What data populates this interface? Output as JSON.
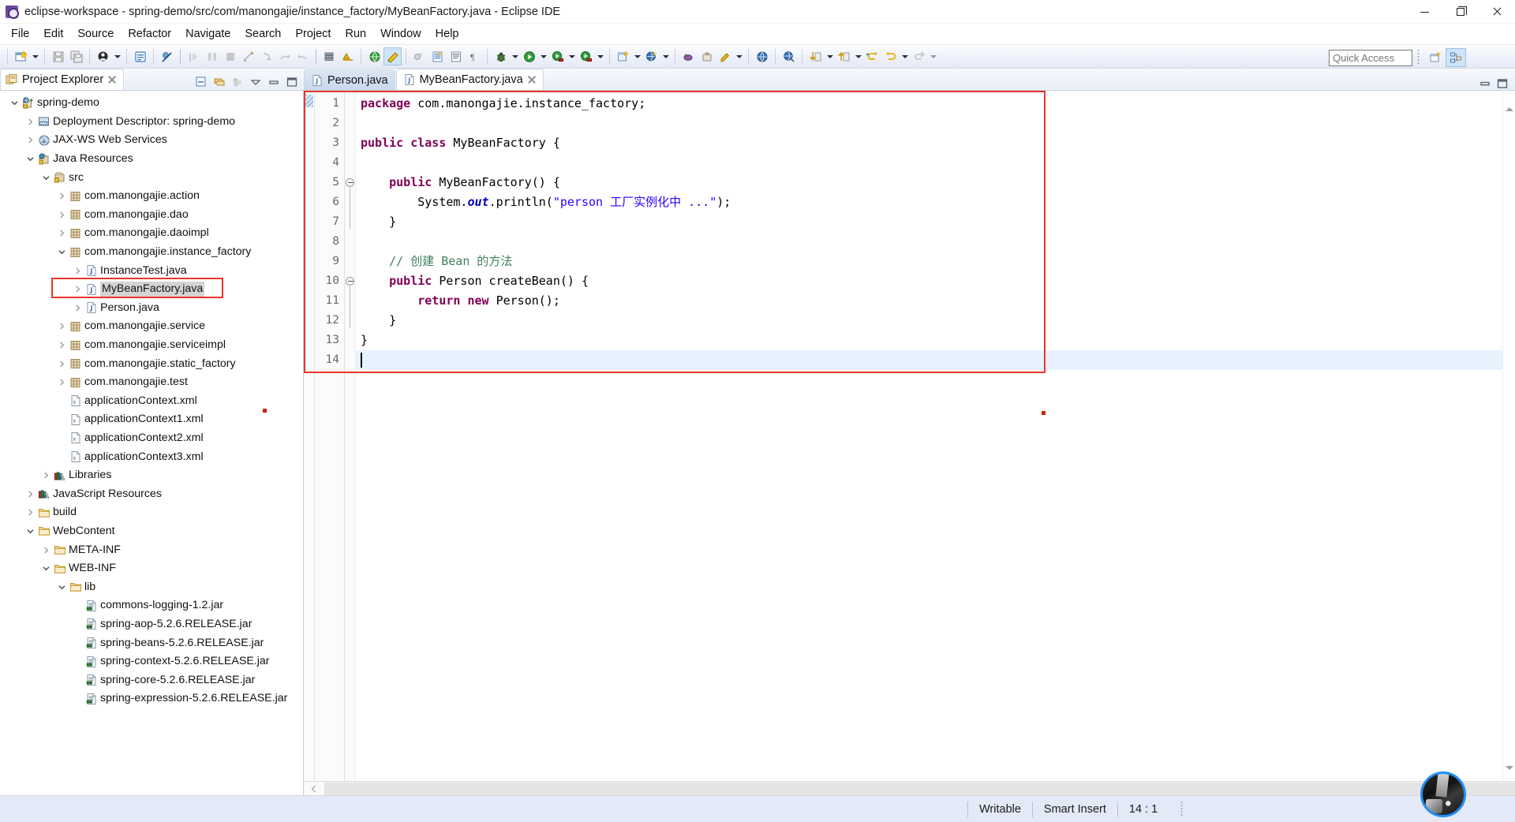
{
  "window": {
    "title": "eclipse-workspace - spring-demo/src/com/manongajie/instance_factory/MyBeanFactory.java - Eclipse IDE",
    "app_icon": "eclipse-icon",
    "minimize_label": "Minimize",
    "maximize_label": "Restore",
    "close_label": "Close"
  },
  "menubar": {
    "items": [
      {
        "label": "File"
      },
      {
        "label": "Edit"
      },
      {
        "label": "Source"
      },
      {
        "label": "Refactor"
      },
      {
        "label": "Navigate"
      },
      {
        "label": "Search"
      },
      {
        "label": "Project"
      },
      {
        "label": "Run"
      },
      {
        "label": "Window"
      },
      {
        "label": "Help"
      }
    ]
  },
  "toolbar": {
    "quick_access_placeholder": "Quick Access",
    "quick_access_value": "",
    "groups": [
      {
        "buttons": [
          {
            "icon": "new-wizard-icon",
            "dropdown": true
          },
          {
            "icon": "save-icon",
            "dropdown": false
          },
          {
            "icon": "save-all-icon",
            "dropdown": false
          }
        ]
      },
      {
        "buttons": [
          {
            "icon": "new-java-class-icon",
            "dropdown": true
          }
        ]
      },
      {
        "buttons": [
          {
            "icon": "open-type-icon",
            "dropdown": false
          }
        ]
      },
      {
        "buttons": [
          {
            "icon": "skip-breakpoints-icon",
            "dropdown": false
          }
        ]
      },
      {
        "buttons": [
          {
            "icon": "resume-icon",
            "dropdown": false
          },
          {
            "icon": "suspend-icon",
            "dropdown": false
          },
          {
            "icon": "terminate-icon",
            "dropdown": false
          },
          {
            "icon": "disconnect-icon",
            "dropdown": false
          },
          {
            "icon": "step-into-icon",
            "dropdown": false
          },
          {
            "icon": "step-over-icon",
            "dropdown": false
          },
          {
            "icon": "step-return-icon",
            "dropdown": false
          }
        ]
      },
      {
        "buttons": [
          {
            "icon": "new-server-icon",
            "dropdown": false
          },
          {
            "icon": "publish-icon",
            "dropdown": false
          }
        ]
      },
      {
        "buttons": [
          {
            "icon": "open-web-browser-icon",
            "dropdown": false
          },
          {
            "icon": "toggle-mark-occurrences-icon",
            "dropdown": false
          }
        ]
      },
      {
        "buttons": [
          {
            "icon": "new-xml-icon",
            "dropdown": false
          },
          {
            "icon": "new-jsp-icon",
            "dropdown": false
          },
          {
            "icon": "show-whitespace-icon",
            "dropdown": false
          }
        ]
      },
      {
        "buttons": [
          {
            "icon": "debug-icon",
            "dropdown": true
          },
          {
            "icon": "run-icon",
            "dropdown": true
          },
          {
            "icon": "run-external-tools-icon",
            "dropdown": true
          },
          {
            "icon": "profile-icon",
            "dropdown": true
          }
        ]
      },
      {
        "buttons": [
          {
            "icon": "new-java-project-icon",
            "dropdown": true
          },
          {
            "icon": "new-package-icon",
            "dropdown": true
          }
        ]
      },
      {
        "buttons": [
          {
            "icon": "search-icon",
            "dropdown": false
          },
          {
            "icon": "open-task-icon",
            "dropdown": false
          },
          {
            "icon": "annotation-icon",
            "dropdown": true
          }
        ]
      },
      {
        "buttons": [
          {
            "icon": "globe-icon",
            "dropdown": false
          }
        ]
      },
      {
        "buttons": [
          {
            "icon": "globe-search-icon",
            "dropdown": false
          }
        ]
      },
      {
        "buttons": [
          {
            "icon": "next-annotation-icon",
            "dropdown": true
          },
          {
            "icon": "previous-annotation-icon",
            "dropdown": true
          }
        ]
      },
      {
        "buttons": [
          {
            "icon": "back-icon",
            "dropdown": false
          },
          {
            "icon": "forward-icon",
            "dropdown": true
          },
          {
            "icon": "last-edit-location-icon",
            "dropdown": true
          }
        ]
      }
    ],
    "perspective_buttons": [
      {
        "icon": "open-perspective-icon",
        "active": false
      },
      {
        "icon": "java-ee-perspective-icon",
        "active": true
      }
    ]
  },
  "explorer": {
    "tab_label": "Project Explorer",
    "tab_icon": "project-explorer-icon",
    "close_icon": "close-icon",
    "view_tools": [
      {
        "icon": "collapse-all-icon"
      },
      {
        "icon": "link-with-editor-icon"
      },
      {
        "icon": "focus-on-active-task-icon"
      },
      {
        "icon": "view-menu-icon"
      },
      {
        "icon": "minimize-view-icon"
      },
      {
        "icon": "maximize-view-icon"
      }
    ],
    "tree": [
      {
        "depth": 0,
        "twisty": "expanded",
        "icon": "dynamic-web-project-icon",
        "label": "spring-demo"
      },
      {
        "depth": 1,
        "twisty": "collapsed",
        "icon": "deployment-descriptor-icon",
        "label": "Deployment Descriptor: spring-demo"
      },
      {
        "depth": 1,
        "twisty": "collapsed",
        "icon": "jaxws-icon",
        "label": "JAX-WS Web Services"
      },
      {
        "depth": 1,
        "twisty": "expanded",
        "icon": "java-resources-icon",
        "label": "Java Resources"
      },
      {
        "depth": 2,
        "twisty": "expanded",
        "icon": "source-folder-icon",
        "label": "src"
      },
      {
        "depth": 3,
        "twisty": "collapsed",
        "icon": "package-icon",
        "label": "com.manongajie.action"
      },
      {
        "depth": 3,
        "twisty": "collapsed",
        "icon": "package-icon",
        "label": "com.manongajie.dao"
      },
      {
        "depth": 3,
        "twisty": "collapsed",
        "icon": "package-icon",
        "label": "com.manongajie.daoimpl"
      },
      {
        "depth": 3,
        "twisty": "expanded",
        "icon": "package-icon",
        "label": "com.manongajie.instance_factory"
      },
      {
        "depth": 4,
        "twisty": "collapsed",
        "icon": "java-file-icon",
        "label": "InstanceTest.java"
      },
      {
        "depth": 4,
        "twisty": "collapsed",
        "icon": "java-file-icon",
        "label": "MyBeanFactory.java",
        "selected": true,
        "highlighted": true
      },
      {
        "depth": 4,
        "twisty": "collapsed",
        "icon": "java-file-icon",
        "label": "Person.java"
      },
      {
        "depth": 3,
        "twisty": "collapsed",
        "icon": "package-icon",
        "label": "com.manongajie.service"
      },
      {
        "depth": 3,
        "twisty": "collapsed",
        "icon": "package-icon",
        "label": "com.manongajie.serviceimpl"
      },
      {
        "depth": 3,
        "twisty": "collapsed",
        "icon": "package-icon",
        "label": "com.manongajie.static_factory"
      },
      {
        "depth": 3,
        "twisty": "collapsed",
        "icon": "package-icon",
        "label": "com.manongajie.test"
      },
      {
        "depth": 3,
        "twisty": "none",
        "icon": "xml-file-icon",
        "label": "applicationContext.xml"
      },
      {
        "depth": 3,
        "twisty": "none",
        "icon": "xml-file-icon",
        "label": "applicationContext1.xml"
      },
      {
        "depth": 3,
        "twisty": "none",
        "icon": "xml-file-icon",
        "label": "applicationContext2.xml"
      },
      {
        "depth": 3,
        "twisty": "none",
        "icon": "xml-file-icon",
        "label": "applicationContext3.xml"
      },
      {
        "depth": 2,
        "twisty": "collapsed",
        "icon": "libraries-icon",
        "label": "Libraries"
      },
      {
        "depth": 1,
        "twisty": "collapsed",
        "icon": "libraries-icon",
        "label": "JavaScript Resources"
      },
      {
        "depth": 1,
        "twisty": "collapsed",
        "icon": "folder-icon",
        "label": "build"
      },
      {
        "depth": 1,
        "twisty": "expanded",
        "icon": "folder-icon",
        "label": "WebContent"
      },
      {
        "depth": 2,
        "twisty": "collapsed",
        "icon": "folder-icon",
        "label": "META-INF"
      },
      {
        "depth": 2,
        "twisty": "expanded",
        "icon": "folder-icon",
        "label": "WEB-INF"
      },
      {
        "depth": 3,
        "twisty": "expanded",
        "icon": "folder-icon",
        "label": "lib"
      },
      {
        "depth": 4,
        "twisty": "none",
        "icon": "jar-icon",
        "label": "commons-logging-1.2.jar"
      },
      {
        "depth": 4,
        "twisty": "none",
        "icon": "jar-icon",
        "label": "spring-aop-5.2.6.RELEASE.jar"
      },
      {
        "depth": 4,
        "twisty": "none",
        "icon": "jar-icon",
        "label": "spring-beans-5.2.6.RELEASE.jar"
      },
      {
        "depth": 4,
        "twisty": "none",
        "icon": "jar-icon",
        "label": "spring-context-5.2.6.RELEASE.jar"
      },
      {
        "depth": 4,
        "twisty": "none",
        "icon": "jar-icon",
        "label": "spring-core-5.2.6.RELEASE.jar"
      },
      {
        "depth": 4,
        "twisty": "none",
        "icon": "jar-icon",
        "label": "spring-expression-5.2.6.RELEASE.jar"
      }
    ]
  },
  "editor": {
    "tabs": [
      {
        "label": "Person.java",
        "icon": "java-file-icon",
        "active": false,
        "closable": false
      },
      {
        "label": "MyBeanFactory.java",
        "icon": "java-file-icon",
        "active": true,
        "closable": true
      }
    ],
    "tab_tools": [
      {
        "icon": "minimize-editor-icon"
      },
      {
        "icon": "maximize-editor-icon"
      }
    ],
    "gutter": [
      "1",
      "2",
      "3",
      "4",
      "5",
      "6",
      "7",
      "8",
      "9",
      "10",
      "11",
      "12",
      "13",
      "14"
    ],
    "fold_lines": [
      5,
      10
    ],
    "current_line": 14,
    "lines": [
      {
        "n": 1,
        "tokens": [
          {
            "t": "package",
            "c": "kw"
          },
          {
            "t": " com.manongajie.instance_factory;",
            "c": ""
          }
        ]
      },
      {
        "n": 2,
        "tokens": []
      },
      {
        "n": 3,
        "tokens": [
          {
            "t": "public",
            "c": "kw"
          },
          {
            "t": " ",
            "c": ""
          },
          {
            "t": "class",
            "c": "kw"
          },
          {
            "t": " MyBeanFactory {",
            "c": ""
          }
        ]
      },
      {
        "n": 4,
        "tokens": []
      },
      {
        "n": 5,
        "tokens": [
          {
            "t": "    ",
            "c": ""
          },
          {
            "t": "public",
            "c": "kw"
          },
          {
            "t": " MyBeanFactory() {",
            "c": ""
          }
        ]
      },
      {
        "n": 6,
        "tokens": [
          {
            "t": "        System.",
            "c": ""
          },
          {
            "t": "out",
            "c": "fld"
          },
          {
            "t": ".println(",
            "c": ""
          },
          {
            "t": "\"person 工厂实例化中 ...\"",
            "c": "str"
          },
          {
            "t": ");",
            "c": ""
          }
        ]
      },
      {
        "n": 7,
        "tokens": [
          {
            "t": "    }",
            "c": ""
          }
        ]
      },
      {
        "n": 8,
        "tokens": []
      },
      {
        "n": 9,
        "tokens": [
          {
            "t": "    ",
            "c": ""
          },
          {
            "t": "// 创建 Bean 的方法",
            "c": "cmt"
          }
        ]
      },
      {
        "n": 10,
        "tokens": [
          {
            "t": "    ",
            "c": ""
          },
          {
            "t": "public",
            "c": "kw"
          },
          {
            "t": " Person createBean() {",
            "c": ""
          }
        ]
      },
      {
        "n": 11,
        "tokens": [
          {
            "t": "        ",
            "c": ""
          },
          {
            "t": "return",
            "c": "kw"
          },
          {
            "t": " ",
            "c": ""
          },
          {
            "t": "new",
            "c": "kw"
          },
          {
            "t": " Person();",
            "c": ""
          }
        ]
      },
      {
        "n": 12,
        "tokens": [
          {
            "t": "    }",
            "c": ""
          }
        ]
      },
      {
        "n": 13,
        "tokens": [
          {
            "t": "}",
            "c": ""
          }
        ]
      },
      {
        "n": 14,
        "tokens": []
      }
    ],
    "highlight_color": "#e8352b",
    "scroll_left_icon": "chevron-left-icon",
    "scroll_up_icon": "chevron-up-icon",
    "scroll_down_icon": "chevron-down-icon"
  },
  "statusbar": {
    "writable": "Writable",
    "insert_mode": "Smart Insert",
    "position": "14 : 1",
    "avatar": "user-avatar"
  },
  "colors": {
    "accent": "#1f8ff5",
    "highlight_red": "#e8352b",
    "keyword": "#7f0055",
    "string": "#2a00ff",
    "comment": "#3f7f5f",
    "field": "#0000c0",
    "status_bg": "#e4e9f7"
  }
}
